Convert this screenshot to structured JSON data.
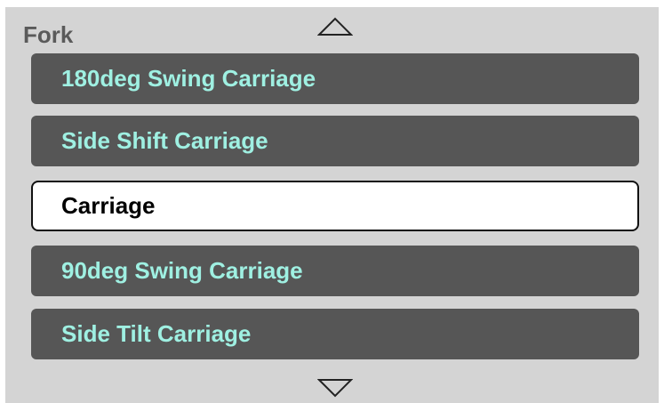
{
  "header": {
    "title": "Fork"
  },
  "icons": {
    "scroll_up": "triangle-up-icon",
    "scroll_down": "triangle-down-icon"
  },
  "colors": {
    "panel_background": "#d4d4d4",
    "item_background": "#565656",
    "item_text": "#9ff0e2",
    "selected_background": "#ffffff",
    "selected_text": "#000000",
    "selected_border": "#111111",
    "title_text": "#5a5a5a"
  },
  "list": {
    "selected_index": 2,
    "items": [
      {
        "label": "180deg Swing Carriage"
      },
      {
        "label": "Side Shift Carriage"
      },
      {
        "label": "Carriage"
      },
      {
        "label": "90deg Swing Carriage"
      },
      {
        "label": "Side Tilt Carriage"
      }
    ]
  }
}
